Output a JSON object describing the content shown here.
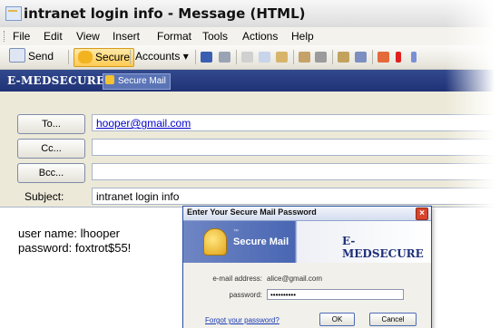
{
  "window": {
    "title": "intranet login info - Message (HTML)"
  },
  "menu": {
    "items": [
      "File",
      "Edit",
      "View",
      "Insert",
      "Format",
      "Tools",
      "Actions",
      "Help"
    ]
  },
  "toolbar": {
    "send_label": "Send",
    "secure_label": "Secure",
    "accounts_label": "Accounts"
  },
  "medsecure_bar": {
    "brand": "E-MEDSECURE",
    "secure_mail_label": "Secure Mail"
  },
  "header": {
    "to_button": "To...",
    "to_value": "hooper@gmail.com",
    "cc_button": "Cc...",
    "cc_value": "",
    "bcc_button": "Bcc...",
    "bcc_value": "",
    "subject_label": "Subject:",
    "subject_value": "intranet login info"
  },
  "body": {
    "line1": "user name:  lhooper",
    "line2": "password: foxtrot$55!"
  },
  "dialog": {
    "title": "Enter Your Secure Mail Password",
    "close_label": "×",
    "banner_tm": "™",
    "banner_label": "Secure Mail",
    "banner_brand": "E-MEDSECURE",
    "email_label": "e-mail address:",
    "email_value": "alice@gmail.com",
    "password_label": "password:",
    "password_value": "••••••••••",
    "forgot_link": "Forgot your password?",
    "ok_label": "OK",
    "cancel_label": "Cancel"
  },
  "colors": {
    "medsecure_bar": "#1f3276",
    "secure_button": "#ffca52",
    "link": "#0000cc"
  },
  "icons": [
    "message-icon",
    "send-icon",
    "secure-lock-icon",
    "save-icon",
    "print-icon",
    "cut-icon",
    "copy-icon",
    "paste-icon",
    "attach-icon",
    "address-book-icon",
    "check-names-icon",
    "options-icon",
    "importance-high-icon",
    "importance-low-icon",
    "padlock-icon",
    "close-icon"
  ]
}
